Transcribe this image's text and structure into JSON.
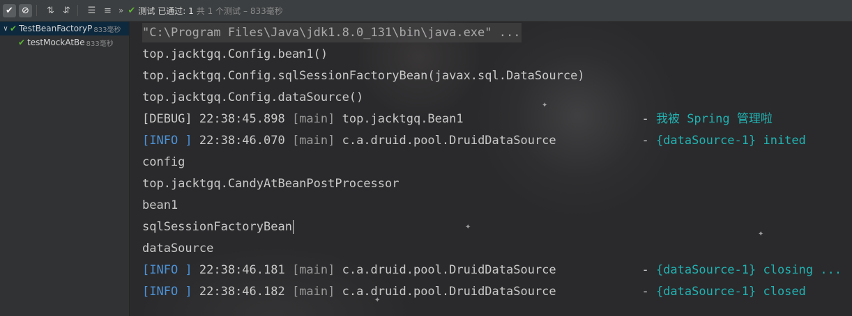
{
  "toolbar": {
    "status_label": "测试",
    "passed_prefix": "已通过: ",
    "passed_count": "1",
    "total_text": "共 1 个测试",
    "duration_text": "– 833毫秒"
  },
  "tree": {
    "items": [
      {
        "label": "TestBeanFactoryP",
        "time": "833毫秒"
      },
      {
        "label": "testMockAtBe",
        "time": "833毫秒"
      }
    ]
  },
  "console": {
    "command": "\"C:\\Program Files\\Java\\jdk1.8.0_131\\bin\\java.exe\" ...",
    "lines": [
      {
        "text": "top.jacktgq.Config.bean1()"
      },
      {
        "text": "top.jacktgq.Config.sqlSessionFactoryBean(javax.sql.DataSource)"
      },
      {
        "text": "top.jacktgq.Config.dataSource()"
      },
      {
        "level": "[DEBUG]",
        "time": " 22:38:45.898 ",
        "thread": "[main]",
        "logger": " top.jacktgq.Bean1                         - ",
        "msg": "我被 Spring 管理啦"
      },
      {
        "level": "[INFO ]",
        "time": " 22:38:46.070 ",
        "thread": "[main]",
        "logger": " c.a.druid.pool.DruidDataSource            - ",
        "msg": "{dataSource-1} inited"
      },
      {
        "text": "config"
      },
      {
        "text": "top.jacktgq.CandyAtBeanPostProcessor"
      },
      {
        "text": "bean1"
      },
      {
        "text": "sqlSessionFactoryBean"
      },
      {
        "text": "dataSource"
      },
      {
        "level": "[INFO ]",
        "time": " 22:38:46.181 ",
        "thread": "[main]",
        "logger": " c.a.druid.pool.DruidDataSource            - ",
        "msg": "{dataSource-1} closing ..."
      },
      {
        "level": "[INFO ]",
        "time": " 22:38:46.182 ",
        "thread": "[main]",
        "logger": " c.a.druid.pool.DruidDataSource            - ",
        "msg": "{dataSource-1} closed"
      }
    ]
  }
}
